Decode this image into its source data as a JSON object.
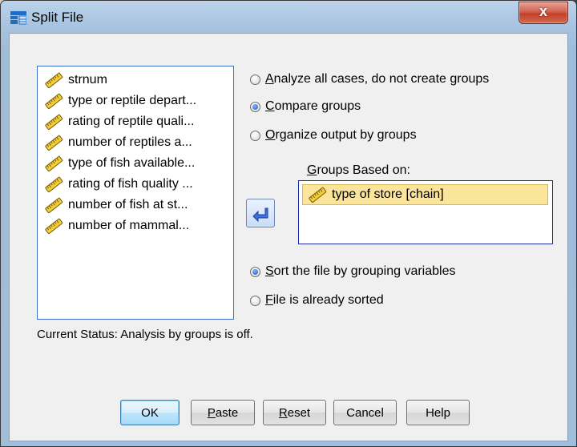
{
  "window": {
    "title": "Split File",
    "close_label": "x"
  },
  "variables": [
    {
      "label": "strnum",
      "icon": "ruler-icon"
    },
    {
      "label": "type or reptile depart...",
      "icon": "ruler-icon"
    },
    {
      "label": "rating of reptile quali...",
      "icon": "ruler-icon"
    },
    {
      "label": "number of reptiles a...",
      "icon": "ruler-icon"
    },
    {
      "label": "type of fish available...",
      "icon": "ruler-icon"
    },
    {
      "label": "rating of fish quality ...",
      "icon": "ruler-icon"
    },
    {
      "label": "number of fish at st...",
      "icon": "ruler-icon"
    },
    {
      "label": "number of mammal...",
      "icon": "ruler-icon"
    }
  ],
  "mode_options": [
    {
      "mnemonic": "A",
      "rest": "nalyze all cases, do not create groups",
      "selected": false
    },
    {
      "mnemonic": "C",
      "rest": "ompare groups",
      "selected": true
    },
    {
      "mnemonic": "O",
      "rest": "rganize output by groups",
      "selected": false
    }
  ],
  "groups": {
    "label_mnemonic": "G",
    "label_rest": "roups Based on:",
    "items": [
      "type of store [chain]"
    ]
  },
  "sort_options": [
    {
      "mnemonic": "S",
      "rest": "ort the file by grouping variables",
      "selected": true
    },
    {
      "mnemonic": "F",
      "rest": "ile is already sorted",
      "selected": false
    }
  ],
  "status": "Current Status: Analysis by groups is off.",
  "buttons": {
    "ok": "OK",
    "paste_mnemonic": "P",
    "paste_rest": "aste",
    "reset_mnemonic": "R",
    "reset_rest": "eset",
    "cancel": "Cancel",
    "help": "Help"
  },
  "colors": {
    "accent": "#3a6fd0",
    "selection": "#fbe59a"
  }
}
